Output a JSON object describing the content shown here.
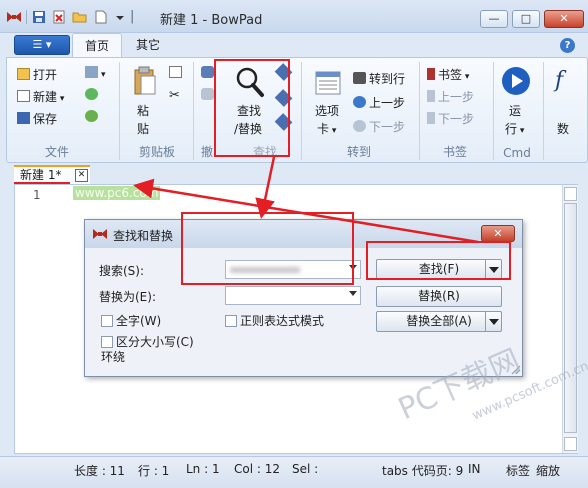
{
  "window": {
    "title": "新建 1 - BowPad",
    "controls": {
      "minimize": "—",
      "maximize": "□",
      "close": "✕"
    }
  },
  "ribbon_tabs": {
    "app_menu": "▾",
    "home": "首页",
    "other": "其它"
  },
  "ribbon": {
    "file": {
      "open": "打开",
      "new": "新建",
      "save": "保存",
      "label": "文件"
    },
    "clipboard": {
      "paste_line1": "粘",
      "paste_line2": "贴",
      "label": "剪贴板"
    },
    "undo": {
      "label": "撤"
    },
    "find": {
      "line1": "查找",
      "line2": "/替换",
      "label": "查找"
    },
    "goto": {
      "options_line1": "选项",
      "options_line2": "卡",
      "goto_line": "转到行",
      "prev": "上一步",
      "next": "下一步",
      "label": "转到"
    },
    "bookmarks": {
      "bookmark": "书签",
      "prev": "上一步",
      "next": "下一步",
      "label": "书签"
    },
    "cmd": {
      "run_line1": "运",
      "run_line2": "行",
      "label": "Cmd"
    },
    "fn": {
      "glyph": "f",
      "line2": "数"
    }
  },
  "document_tab": {
    "label": "新建 1*",
    "close": "✕"
  },
  "editor": {
    "line_number": "1",
    "text": "www.pc6.com"
  },
  "find_dialog": {
    "title": "查找和替换",
    "search_label": "搜索(S):",
    "replace_label": "替换为(E):",
    "find_button": "查找(F)",
    "replace_button": "替换(R)",
    "replace_all_button": "替换全部(A)",
    "whole_word": "全字(W)",
    "regex": "正则表达式模式",
    "match_case": "区分大小写(C)",
    "wrap": "环绕",
    "close": "✕"
  },
  "statusbar": {
    "length": "长度 : 11",
    "line": "行 : 1",
    "ln": "Ln : 1",
    "col": "Col : 12",
    "sel": "Sel :",
    "tabs": "tabs 代码页: 9",
    "ins": "IN",
    "bookmark": "标签",
    "zoom": "缩放"
  },
  "watermark": {
    "text": "PC下载网",
    "url": "www.pcsoft.com.cn"
  },
  "colors": {
    "annotation_red": "#e31e24",
    "ribbon_blue": "#1d58ae"
  }
}
